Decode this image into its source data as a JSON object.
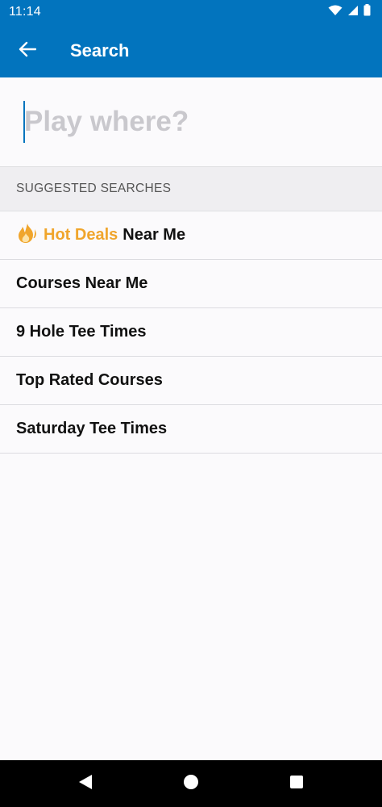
{
  "status_bar": {
    "time": "11:14"
  },
  "app_bar": {
    "title": "Search"
  },
  "search": {
    "placeholder": "Play where?",
    "value": ""
  },
  "suggested": {
    "header": "SUGGESTED SEARCHES",
    "hot_deals": {
      "hot_label": "Hot Deals",
      "rest_label": "Near Me"
    },
    "items": [
      {
        "label": "Courses Near Me"
      },
      {
        "label": "9 Hole Tee Times"
      },
      {
        "label": "Top Rated Courses"
      },
      {
        "label": "Saturday Tee Times"
      }
    ]
  },
  "colors": {
    "brand": "#0274be",
    "hot": "#f0a52c"
  },
  "icons": {
    "back": "arrow-left-icon",
    "hot_deals": "fire-icon",
    "nav_back": "triangle-back-icon",
    "nav_home": "circle-home-icon",
    "nav_recents": "square-recents-icon"
  }
}
